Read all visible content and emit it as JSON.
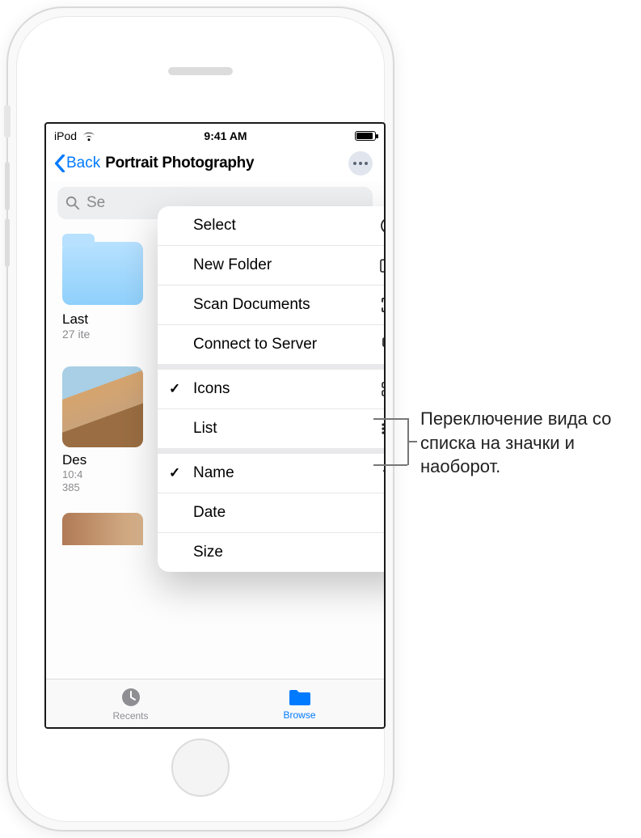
{
  "status_bar": {
    "carrier": "iPod",
    "time": "9:41 AM"
  },
  "nav": {
    "back_label": "Back",
    "title": "Portrait Photography"
  },
  "search": {
    "placeholder": "Search",
    "partial": "Se"
  },
  "folder": {
    "name_partial": "Last ",
    "sub_partial": "27 ite"
  },
  "thumb": {
    "name_partial": "Des",
    "time_partial": "10:4",
    "size_partial": "385"
  },
  "menu": {
    "items": [
      {
        "label": "Select",
        "icon": "select-circle",
        "checked": false
      },
      {
        "label": "New Folder",
        "icon": "new-folder",
        "checked": false
      },
      {
        "label": "Scan Documents",
        "icon": "scan",
        "checked": false
      },
      {
        "label": "Connect to Server",
        "icon": "server",
        "checked": false
      },
      {
        "label": "Icons",
        "icon": "grid",
        "checked": true
      },
      {
        "label": "List",
        "icon": "list",
        "checked": false
      },
      {
        "label": "Name",
        "icon": "chevron-down",
        "checked": true
      },
      {
        "label": "Date",
        "icon": "",
        "checked": false
      },
      {
        "label": "Size",
        "icon": "",
        "checked": false
      }
    ]
  },
  "tabs": {
    "recents": "Recents",
    "browse": "Browse"
  },
  "callout": {
    "text": "Переключение вида со списка на значки и наоборот."
  }
}
